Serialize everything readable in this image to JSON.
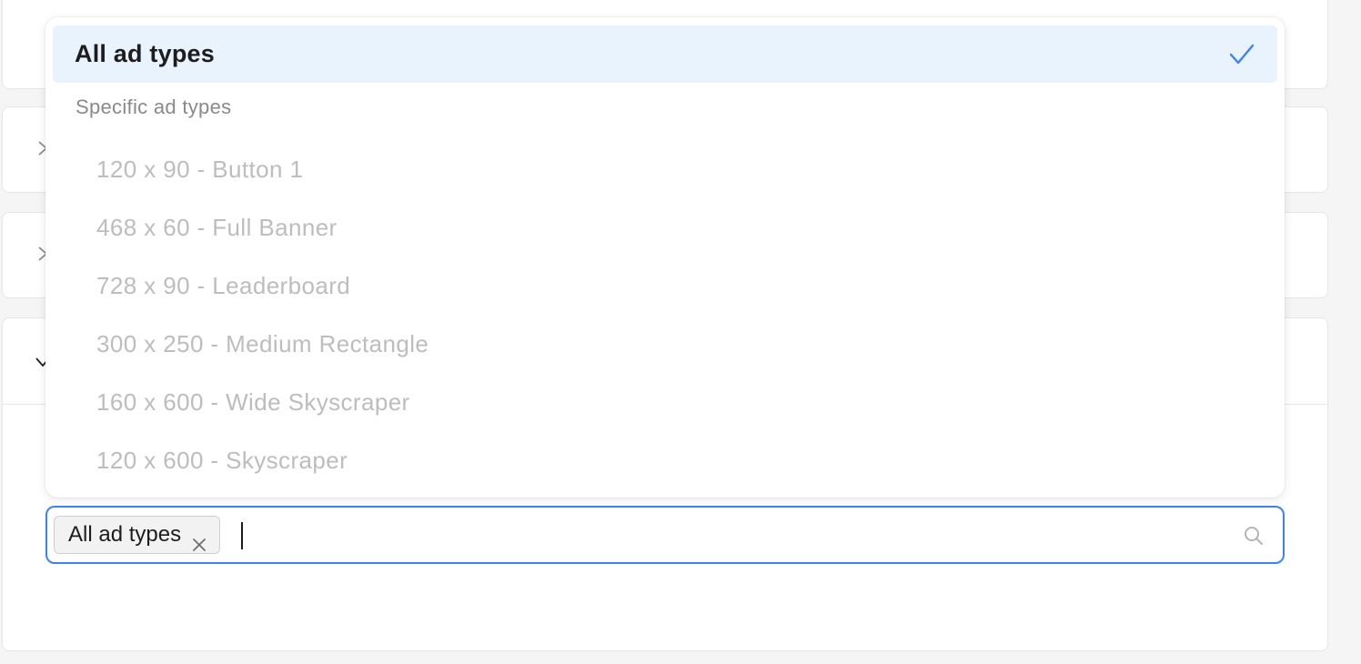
{
  "dropdown": {
    "selected_option": "All ad types",
    "group_label": "Specific ad types",
    "options": [
      "120 x 90 - Button 1",
      "468 x 60 - Full Banner",
      "728 x 90 - Leaderboard",
      "300 x 250 - Medium Rectangle",
      "160 x 600 - Wide Skyscraper",
      "120 x 600 - Skyscraper"
    ]
  },
  "input": {
    "tag_label": "All ad types",
    "value": ""
  },
  "colors": {
    "accent": "#3b82f6",
    "selected_bg": "#e9f3fd",
    "disabled_text": "#bdbdbd"
  },
  "icons": [
    "chevron-right-icon",
    "chevron-down-icon",
    "checkmark-icon",
    "close-icon",
    "search-icon"
  ]
}
